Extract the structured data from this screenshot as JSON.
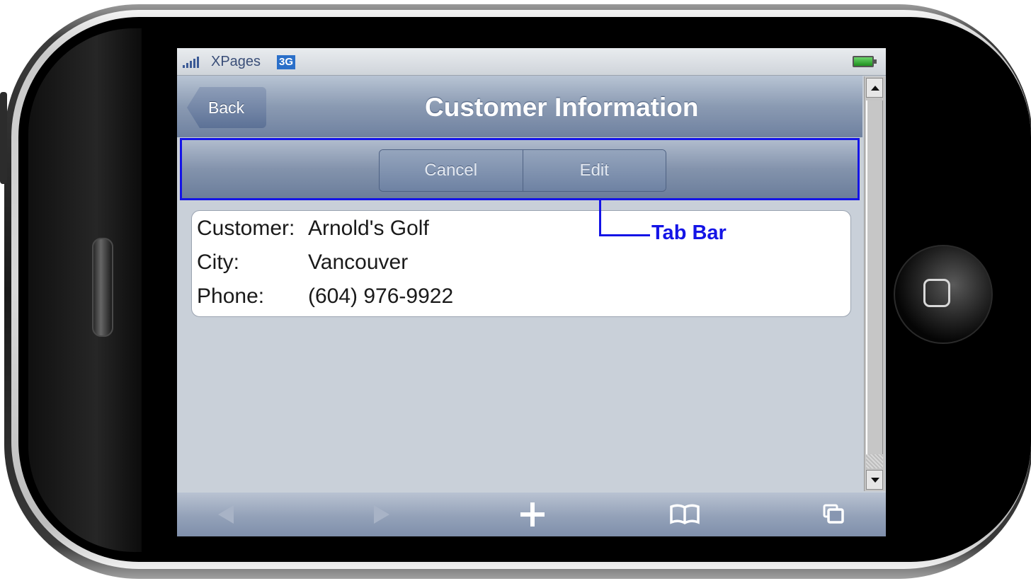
{
  "status_bar": {
    "carrier": "XPages",
    "network": "3G"
  },
  "nav_bar": {
    "back_label": "Back",
    "title": "Customer Information"
  },
  "tab_bar": {
    "cancel_label": "Cancel",
    "edit_label": "Edit"
  },
  "customer": {
    "rows": [
      {
        "label": "Customer:",
        "value": "Arnold's Golf"
      },
      {
        "label": "City:",
        "value": "Vancouver"
      },
      {
        "label": "Phone:",
        "value": "(604) 976-9922"
      }
    ]
  },
  "annotation": {
    "label": "Tab Bar",
    "color": "#1414e6"
  },
  "browser_toolbar": {
    "icons": [
      "back-arrow-icon",
      "forward-arrow-icon",
      "plus-icon",
      "bookmarks-icon",
      "pages-icon"
    ]
  },
  "colors": {
    "nav_bar": "#8a9ab2",
    "screen_background": "#c9d0d9",
    "annotation_blue": "#1414e6"
  }
}
